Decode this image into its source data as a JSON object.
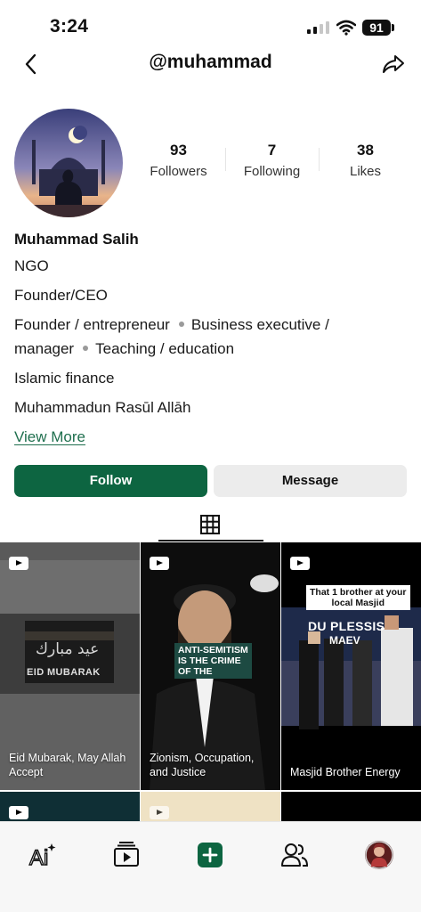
{
  "status_bar": {
    "time": "3:24",
    "battery": "91"
  },
  "header": {
    "handle": "@muhammad"
  },
  "profile": {
    "stats": [
      {
        "value": "93",
        "label": "Followers"
      },
      {
        "value": "7",
        "label": "Following"
      },
      {
        "value": "38",
        "label": "Likes"
      }
    ],
    "name": "Muhammad Salih",
    "bio": {
      "line1": "NGO",
      "line2": "Founder/CEO",
      "tag1": "Founder / entrepreneur",
      "tag2": "Business executive /",
      "tag2b": "manager",
      "tag3": "Teaching / education",
      "line5": "Islamic finance",
      "line6": "Muhammadun Rasūl Allāh"
    },
    "view_more": "View More"
  },
  "actions": {
    "follow": "Follow",
    "message": "Message"
  },
  "posts": [
    {
      "caption": "Eid Mubarak, May Allah Accept",
      "overlay1": "عيد مبارك",
      "overlay2": "EID MUBARAK"
    },
    {
      "caption": "Zionism, Occupation, and Justice",
      "overlay1": "ANTI-SEMITISM",
      "overlay2": "IS THE CRIME",
      "overlay3": "OF THE"
    },
    {
      "caption": "Masjid Brother Energy",
      "overlay1": "That 1 brother at your",
      "overlay2": "local Masjid",
      "overlay3": "DU PLESSIS",
      "overlay4": "MAEV"
    }
  ],
  "icons": {
    "back": "chevron-left-icon",
    "share": "share-arrow-icon",
    "grid": "grid-icon",
    "play": "video-icon",
    "nav": [
      "ai-sparkle-icon",
      "video-feed-icon",
      "plus-icon",
      "people-icon",
      "avatar-icon"
    ]
  },
  "colors": {
    "accent": "#0d6541",
    "link": "#1f6f4e",
    "button_secondary": "#ececec"
  }
}
